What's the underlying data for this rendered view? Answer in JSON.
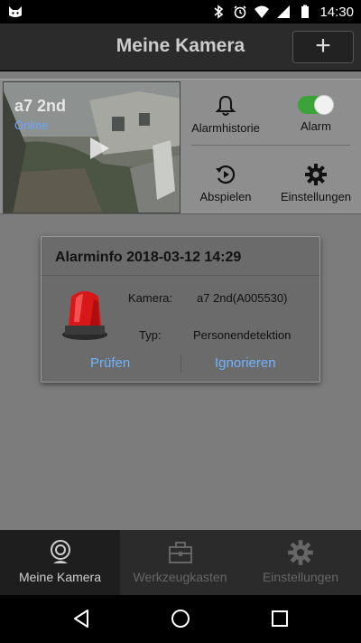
{
  "status_bar": {
    "time": "14:30",
    "icons": [
      "cat-app-icon",
      "bluetooth-icon",
      "alarm-clock-icon",
      "wifi-icon",
      "signal-icon",
      "battery-icon"
    ]
  },
  "app_bar": {
    "title": "Meine Kamera",
    "add_label": "+"
  },
  "camera": {
    "name": "a7 2nd",
    "status": "Online",
    "actions": {
      "alarm_history": "Alarmhistorie",
      "alarm": "Alarm",
      "alarm_enabled": true,
      "play": "Abspielen",
      "settings": "Einstellungen"
    }
  },
  "alarm_dialog": {
    "title": "Alarminfo 2018-03-12 14:29",
    "camera_label": "Kamera:",
    "camera_value": "a7 2nd(A005530)",
    "type_label": "Typ:",
    "type_value": "Personendetektion",
    "check_label": "Prüfen",
    "ignore_label": "Ignorieren"
  },
  "tabs": [
    {
      "label": "Meine Kamera",
      "icon": "webcam-icon",
      "active": true
    },
    {
      "label": "Werkzeugkasten",
      "icon": "toolbox-icon",
      "active": false
    },
    {
      "label": "Einstellungen",
      "icon": "gear-icon",
      "active": false
    }
  ],
  "colors": {
    "accent_blue": "#6fb3ff",
    "toggle_green": "#3aa33a",
    "siren_red": "#d81818"
  }
}
